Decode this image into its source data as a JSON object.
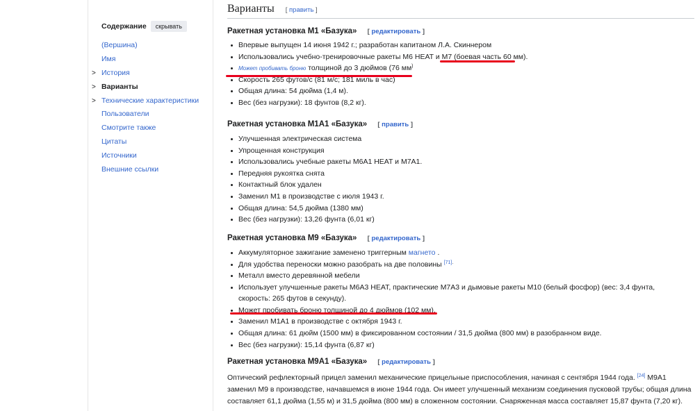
{
  "toc": {
    "title": "Содержание",
    "toggle": "скрывать",
    "items": [
      {
        "label": "(Вершина)",
        "chevron": "",
        "current": false
      },
      {
        "label": "Имя",
        "chevron": "",
        "current": false
      },
      {
        "label": "История",
        "chevron": ">",
        "current": false
      },
      {
        "label": "Варианты",
        "chevron": ">",
        "current": true
      },
      {
        "label": "Технические характеристики",
        "chevron": ">",
        "current": false
      },
      {
        "label": "Пользователи",
        "chevron": "",
        "current": false
      },
      {
        "label": "Смотрите также",
        "chevron": "",
        "current": false
      },
      {
        "label": "Цитаты",
        "chevron": "",
        "current": false
      },
      {
        "label": "Источники",
        "chevron": "",
        "current": false
      },
      {
        "label": "Внешние ссылки",
        "chevron": "",
        "current": false
      }
    ]
  },
  "section": {
    "title": "Варианты",
    "bracket_open": "[",
    "bracket_close": "]",
    "edit_label": "править"
  },
  "m1": {
    "title": "Ракетная установка М1 «Базука»",
    "edit_label": "редактировать",
    "items": [
      "Впервые выпущен 14 июня 1942 г.; разработан капитаном Л.А. Скиннером",
      "Использовались учебно-тренировочные ракеты M6 HEAT и M7",
      "Скорость 265 футов/с (81 м/с; 181 миль в час)",
      "Общая длина: 54 дюйма (1,4 м).",
      "Вес (без нагрузки): 18 фунтов (8,2 кг)."
    ],
    "warhead_note": "(боевая часть 60 мм).",
    "armor_small": "Может пробивать броню",
    "armor_rest": "толщиной до 3 дюймов (76 мм",
    "armor_sup": ")"
  },
  "m1a1": {
    "title": "Ракетная установка M1A1 «Базука»",
    "edit_label": "править",
    "items": [
      "Улучшенная электрическая система",
      "Упрощенная конструкция",
      "Использовались учебные ракеты M6A1 HEAT и M7A1.",
      "Передняя рукоятка снята",
      "Контактный блок удален",
      "Заменил М1 в производстве с июля 1943 г.",
      "Общая длина: 54,5 дюйма (1380 мм)",
      "Вес (без нагрузки): 13,26 фунта (6,01 кг)"
    ]
  },
  "m9": {
    "title": "Ракетная установка М9 «Базука»",
    "edit_label": "редактировать",
    "item1_text": "Аккумуляторное зажигание заменено триггерным",
    "item1_link": "магнето",
    "item1_end": ".",
    "item2_text": "Для удобства переноски можно разобрать на две половины",
    "item2_ref": "[71]",
    "item2_end": ".",
    "item3": "Металл вместо деревянной мебели",
    "item4": "Использует улучшенные ракеты M6A3 HEAT, практические M7A3 и дымовые ракеты M10 (белый фосфор) (вес: 3,4 фунта, скорость: 265 футов в секунду).",
    "item5": "Может пробивать броню толщиной до 4 дюймов (102 мм).",
    "item6": "Заменил M1A1 в производстве с октября 1943 г.",
    "item7": "Общая длина: 61 дюйм (1500 мм) в фиксированном состоянии / 31,5 дюйма (800 мм) в разобранном виде.",
    "item8": "Вес (без нагрузки): 15,14 фунта (6,87 кг)"
  },
  "m9a1": {
    "title": "Ракетная установка M9A1 «Базука»",
    "edit_label": "редактировать",
    "para_a": "Оптический рефлекторный прицел заменил механические прицельные приспособления, начиная с сентября 1944 года.",
    "para_ref": "[24]",
    "para_b": "M9A1 заменил M9 в производстве, начавшемся в июне 1944 года. Он имеет улучшенный механизм соединения пусковой трубы; общая длина составляет 61,1 дюйма (1,55 м) и 31,5 дюйма (800 мм) в сложенном состоянии. Снаряженная масса составляет 15,87 фунта (7,20 кг)."
  },
  "colors": {
    "link": "#3366cc",
    "text": "#202122",
    "highlight_underline": "#e8001c"
  }
}
